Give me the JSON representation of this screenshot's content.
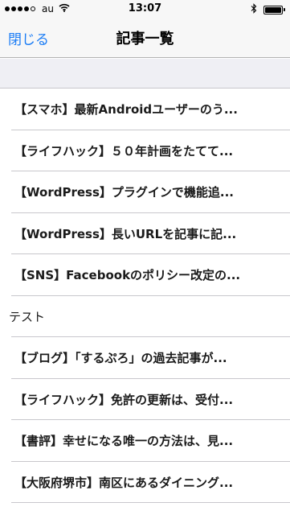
{
  "statusbar": {
    "carrier": "au",
    "time": "13:07",
    "signal_bars": 4,
    "signal_total": 5,
    "battery_level": 1.0
  },
  "navbar": {
    "close_label": "閉じる",
    "title": "記事一覧"
  },
  "articles": [
    "【スマホ】最新Androidユーザーのう...",
    "【ライフハック】５０年計画をたてて...",
    "【WordPress】プラグインで機能追...",
    "【WordPress】長いURLを記事に記...",
    "【SNS】Facebookのポリシー改定の...",
    "テスト",
    "【ブログ】「するぷろ」の過去記事が...",
    "【ライフハック】免許の更新は、受付...",
    "【書評】幸せになる唯一の方法は、見...",
    "【大阪府堺市】南区にあるダイニング..."
  ],
  "colors": {
    "accent": "#1a7cf5",
    "bar_background": "#f7f7f7",
    "section_background": "#efeff4",
    "separator": "#c8c7cc"
  }
}
